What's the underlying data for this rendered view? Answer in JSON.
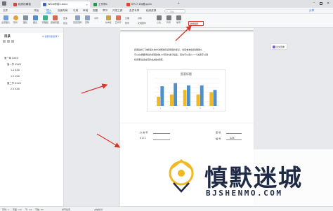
{
  "colors": {
    "accent": "#2c6bd8",
    "wps_red": "#e0422f",
    "chart_blue": "#4e8fce",
    "chart_orange": "#f2b820",
    "annotation_red": "#d9352b"
  },
  "title_bar": {
    "tabs": [
      {
        "label": "稻壳找模板",
        "icon": "docer-icon",
        "color": "#e0422f"
      },
      {
        "label": "Word修用2.docx",
        "icon": "word-doc-icon",
        "color": "#2c6bd8"
      },
      {
        "label": "工作簿1",
        "icon": "spreadsheet-icon",
        "color": "#1b9e4b"
      },
      {
        "label": "KPI-7.1标题.pptx",
        "icon": "presentation-icon",
        "color": "#e0422f"
      }
    ],
    "window_controls": [
      "minimize-icon",
      "maximize-icon",
      "close-icon"
    ]
  },
  "menu": {
    "file_label": "文件",
    "items": [
      "开始",
      "插入",
      "页面布局",
      "引用",
      "审阅",
      "视图",
      "章节",
      "开发工具",
      "会员专享",
      "稻壳资源"
    ],
    "active_index": 1,
    "search_placeholder": "查找",
    "share_label": "分享"
  },
  "ribbon": {
    "buttons": [
      "全家图片",
      "形状",
      "图标",
      "图表",
      "流程图",
      "思维导图",
      "更多",
      "批注",
      "页眉页脚",
      "页码",
      "水印",
      "文本框",
      "艺术字",
      "日期",
      "附件",
      "对象",
      "文档部件",
      "公式",
      "符号",
      "编号"
    ],
    "callout_label": "智能图形"
  },
  "nav": {
    "title": "目录",
    "smart_label": "智能识别目录",
    "items": [
      {
        "label": "第一章 XXXX",
        "level": 1
      },
      {
        "label": "第一节 XXXX",
        "level": 2
      },
      {
        "label": "1.1 XXX",
        "level": 3
      },
      {
        "label": "1.2 XXX",
        "level": 3
      },
      {
        "label": "第二节 XXXX",
        "level": 2
      },
      {
        "label": "2.1 XXX",
        "level": 3
      }
    ]
  },
  "document": {
    "paragraph_lines": [
      "视频提供了功能强大的方法帮助您证明您的观点。当您单击联机视频时，",
      "可以在想要添加的视频的嵌入代码中进行粘贴。您也可以键入一个关键字以联",
      "机搜索最适合您的文档的视频。"
    ],
    "form_labels": [
      "分 类 号",
      "U D C",
      "密 级",
      "编 号"
    ],
    "form_value": "GXX",
    "side_panel_label": "论文查重"
  },
  "chart_data": {
    "type": "bar",
    "title": "图表标题",
    "categories": [
      "1",
      "2",
      "3",
      "4",
      "5"
    ],
    "series": [
      {
        "name": "",
        "color": "#f2b820",
        "values": [
          2.0,
          2.5,
          3.5,
          2.5,
          3.0
        ]
      },
      {
        "name": "",
        "color": "#4e8fce",
        "values": [
          4.3,
          5.0,
          4.5,
          4.5,
          3.5
        ]
      }
    ],
    "ylim": [
      0,
      6
    ],
    "grid": true
  },
  "status_bar": {
    "left": [
      "页码: 1",
      "页面: 1/2",
      "节: 1/1",
      "字数: 89",
      "拼写检查",
      "文档校对"
    ],
    "zoom": "100%"
  },
  "watermark": {
    "brand": "慎默迷城",
    "url": "BJSHENMO.COM"
  }
}
